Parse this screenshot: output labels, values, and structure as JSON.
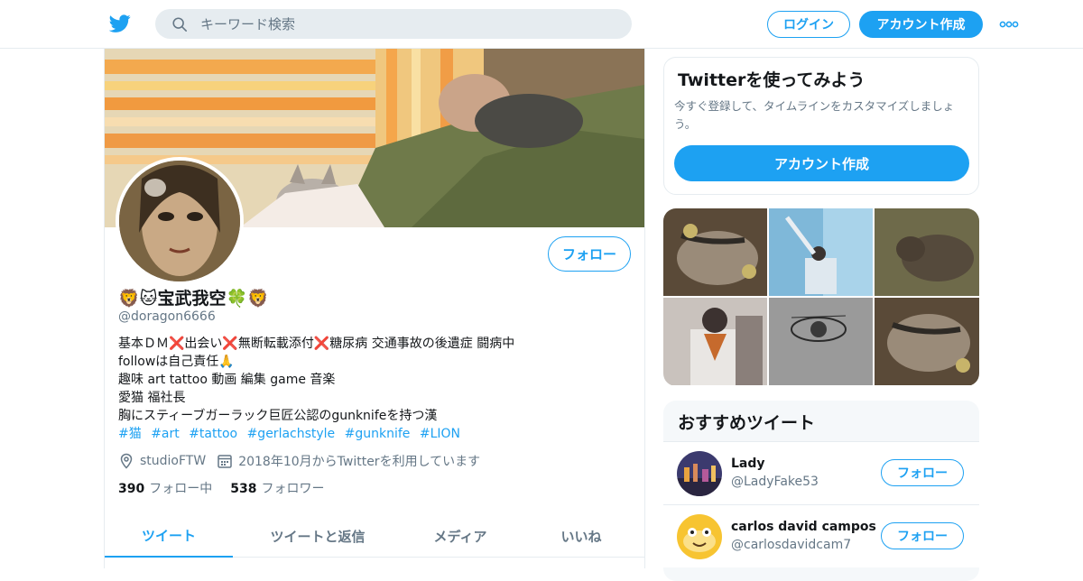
{
  "colors": {
    "accent": "#1da1f2",
    "text": "#14171a",
    "muted": "#657786",
    "border": "#e6ecf0"
  },
  "header": {
    "logo_icon": "twitter-bird-icon",
    "search_icon": "search-icon",
    "search_placeholder": "キーワード検索",
    "login_label": "ログイン",
    "signup_label": "アカウント作成",
    "more_icon": "more-dots-icon"
  },
  "profile": {
    "name": "🦁🐱宝武我空🍀🦁",
    "handle": "@doragon6666",
    "follow_label": "フォロー",
    "bio_lines": [
      "基本ＤＭ❌出会い❌無断転載添付❌糖尿病 交通事故の後遺症 闘病中",
      "followは自己責任🙏",
      "趣味 art tattoo 動画 編集 game 音楽",
      "愛猫 福社長",
      "胸にスティーブガーラック巨匠公認のgunknifeを持つ漢"
    ],
    "hashtags": [
      "#猫",
      "#art",
      "#tattoo",
      "#gerlachstyle",
      "#gunknife",
      "#LION"
    ],
    "location": "studioFTW",
    "joined": "2018年10月からTwitterを利用しています",
    "following_count": "390",
    "following_label": "フォロー中",
    "followers_count": "538",
    "followers_label": "フォロワー"
  },
  "tabs": [
    {
      "label": "ツイート",
      "active": true
    },
    {
      "label": "ツイートと返信",
      "active": false
    },
    {
      "label": "メディア",
      "active": false
    },
    {
      "label": "いいね",
      "active": false
    }
  ],
  "signup_card": {
    "title": "Twitterを使ってみよう",
    "subtitle": "今すぐ登録して、タイムラインをカスタマイズしましょう。",
    "button_label": "アカウント作成"
  },
  "recommendations": {
    "title": "おすすめツイート",
    "items": [
      {
        "name": "Lady",
        "handle": "@LadyFake53",
        "follow_label": "フォロー"
      },
      {
        "name": "carlos david campos",
        "handle": "@carlosdavidcam7",
        "follow_label": "フォロー"
      }
    ]
  }
}
